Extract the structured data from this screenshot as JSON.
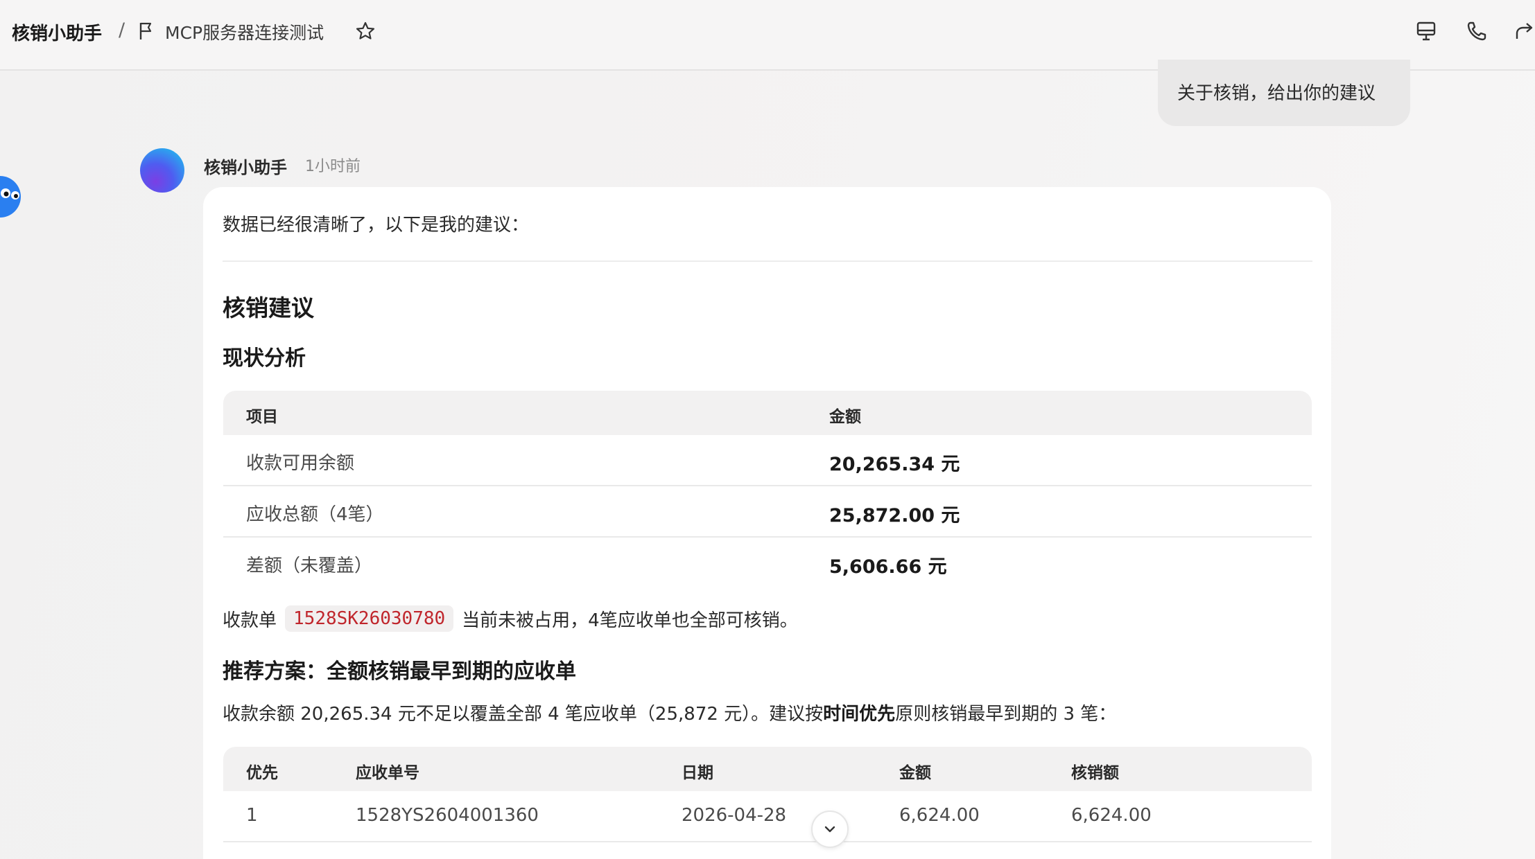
{
  "header": {
    "app_title": "核销小助手",
    "separator": "/",
    "conversation_title": "MCP服务器连接测试"
  },
  "user_message": "关于核销，给出你的建议",
  "assistant": {
    "name": "核销小助手",
    "time": "1小时前",
    "intro": "数据已经很清晰了，以下是我的建议：",
    "heading": "核销建议",
    "section1_title": "现状分析",
    "table1": {
      "headers": [
        "项目",
        "金额"
      ],
      "rows": [
        [
          "收款可用余额",
          "20,265.34 元"
        ],
        [
          "应收总额（4笔）",
          "25,872.00 元"
        ],
        [
          "差额（未覆盖）",
          "5,606.66 元"
        ]
      ]
    },
    "note_prefix": "收款单",
    "note_code": "1528SK26030780",
    "note_suffix": "当前未被占用，4笔应收单也全部可核销。",
    "section2_title": "推荐方案：全额核销最早到期的应收单",
    "para_before": "收款余额 20,265.34 元不足以覆盖全部 4 笔应收单（25,872 元）。建议按",
    "para_bold": "时间优先",
    "para_after": "原则核销最早到期的 3 笔：",
    "table2": {
      "headers": [
        "优先",
        "应收单号",
        "日期",
        "金额",
        "核销额"
      ],
      "rows": [
        [
          "1",
          "1528YS2604001360",
          "2026-04-28",
          "6,624.00",
          "6,624.00"
        ]
      ]
    }
  },
  "icons": {
    "flag": "flag-icon",
    "star": "star-icon",
    "present": "presentation-icon",
    "phone": "phone-icon",
    "share": "share-icon",
    "scroll": "chevron-down-icon"
  },
  "colors": {
    "code_text": "#c0262c",
    "avatar_gradient": [
      "#7b3fe4",
      "#2aa7ef"
    ]
  }
}
